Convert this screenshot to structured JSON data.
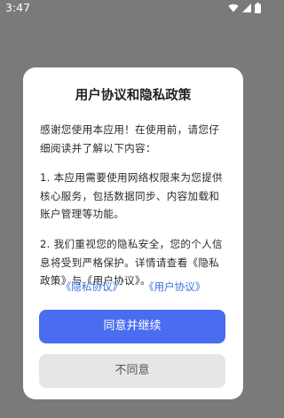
{
  "status_bar": {
    "time": "3:47"
  },
  "dialog": {
    "title": "用户协议和隐私政策",
    "paragraphs": [
      "感谢您使用本应用！在使用前，请您仔细阅读并了解以下内容：",
      "1. 本应用需要使用网络权限来为您提供核心服务，包括数据同步、内容加载和账户管理等功能。",
      "2. 我们重视您的隐私安全，您的个人信息将受到严格保护。详情请查看《隐私政策》与《用户协议》。"
    ],
    "links": {
      "privacy": "《隐私协议》",
      "user": "《用户协议》"
    },
    "agree_button": "同意并继续",
    "disagree_button": "不同意"
  },
  "colors": {
    "overlay": "#7a7a7a",
    "accent": "#4a6cf0",
    "link": "#3b6fe0",
    "secondary_button": "#e6e6e6"
  },
  "icons": {
    "wifi": "wifi-icon",
    "signal": "cell-signal-icon",
    "battery": "battery-icon"
  }
}
